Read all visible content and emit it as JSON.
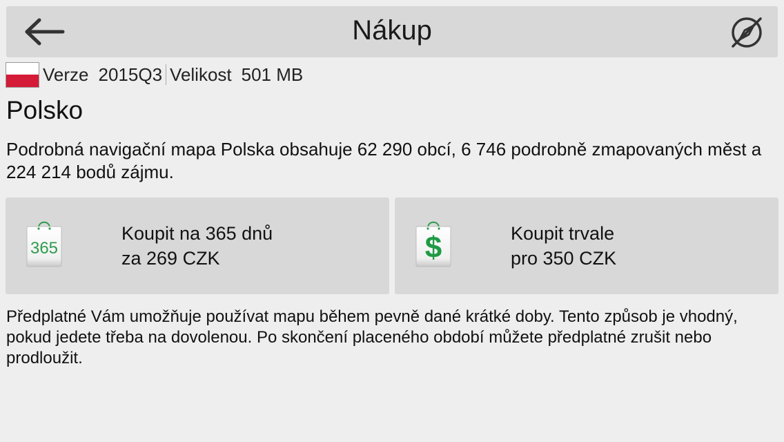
{
  "header": {
    "title": "Nákup",
    "back_icon": "arrow-left-icon",
    "gps_icon": "gps-off-icon"
  },
  "info": {
    "flag": "poland-flag",
    "version_label": "Verze",
    "version_value": "2015Q3",
    "size_label": "Velikost",
    "size_value": "501 MB"
  },
  "map": {
    "country": "Polsko",
    "description": "Podrobná navigační mapa Polska obsahuje 62 290 obcí, 6 746 podrobně zmapovaných měst a 224 214 bodů zájmu."
  },
  "options": [
    {
      "icon": "shopping-bag-365-icon",
      "badge": "365",
      "line1": "Koupit na 365 dnů",
      "line2": "za 269 CZK"
    },
    {
      "icon": "shopping-bag-dollar-icon",
      "badge": "$",
      "line1": "Koupit trvale",
      "line2": "pro 350 CZK"
    }
  ],
  "note": "Předplatné Vám umožňuje používat mapu během pevně dané krátké doby. Tento způsob je vhodný, pokud jedete třeba na dovolenou. Po skončení placeného období můžete předplatné zrušit nebo prodloužit.",
  "colors": {
    "accent_green": "#2e9c4e",
    "flag_red": "#d41b37",
    "panel_gray": "#d8d8d8",
    "background": "#eeeeee"
  }
}
